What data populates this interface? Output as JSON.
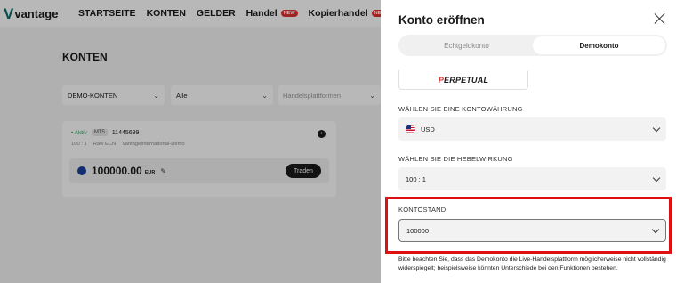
{
  "nav": {
    "logo_mark": "V",
    "logo_text": "vantage",
    "items": [
      {
        "label": "STARTSEITE",
        "badge": ""
      },
      {
        "label": "KONTEN",
        "badge": ""
      },
      {
        "label": "GELDER",
        "badge": ""
      },
      {
        "label": "Handel",
        "badge": "NEW"
      },
      {
        "label": "Kopierhandel",
        "badge": "NEW"
      }
    ]
  },
  "page": {
    "title": "KONTEN",
    "filters": {
      "account_type": "DEMO-KONTEN",
      "status": "Alle",
      "platform_placeholder": "Handelsplattformen"
    }
  },
  "account": {
    "status": "• Aktiv",
    "type": "MT5",
    "number": "11445699",
    "leverage": "100 : 1",
    "kind": "Raw ECN",
    "server": "VantageInternational-Demo",
    "balance": "100000.00",
    "currency": "EUR",
    "trade_label": "Traden",
    "more_icon": "more-icon",
    "edit_icon": "pencil-icon"
  },
  "drawer": {
    "title": "Konto eröffnen",
    "tabs": [
      {
        "label": "Echtgeldkonto",
        "active": false
      },
      {
        "label": "Demokonto",
        "active": true
      }
    ],
    "platform_logo_accent": "P",
    "platform_logo_rest": "ERPETUAL",
    "currency_label": "WÄHLEN SIE EINE KONTOWÄHRUNG",
    "currency_value": "USD",
    "leverage_label": "WÄHLEN SIE DIE HEBELWIRKUNG",
    "leverage_value": "100 : 1",
    "balance_label": "KONTOSTAND",
    "balance_value": "100000",
    "note": "Bitte beachten Sie, dass das Demokonto die Live-Handelsplattform möglicherweise nicht vollständig widerspiegelt; beispielsweise könnten Unterschiede bei den Funktionen bestehen.",
    "highlight_color": "#e01010"
  }
}
